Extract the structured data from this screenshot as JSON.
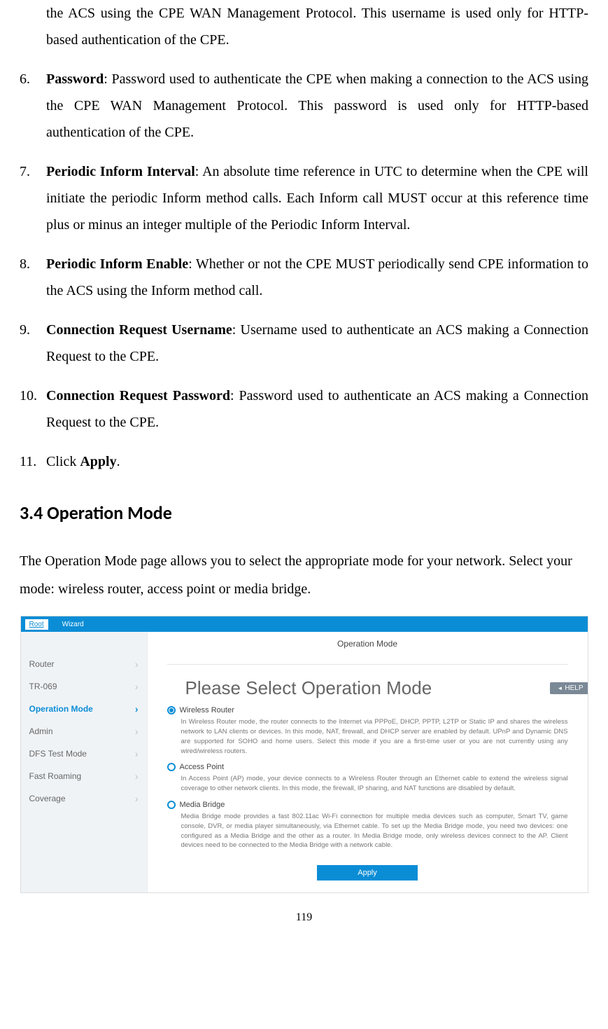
{
  "list": {
    "item5_cont": "the ACS using the CPE WAN Management Protocol. This username is used only for HTTP-based authentication of the CPE.",
    "item6_num": "6.",
    "item6_bold": "Password",
    "item6_text": ": Password used to authenticate the CPE when making a connection to the ACS using the CPE WAN Management Protocol. This password is used only for HTTP-based authentication of the CPE.",
    "item7_num": "7.",
    "item7_bold": "Periodic Inform Interval",
    "item7_text": ": An absolute time reference in UTC to determine when the CPE will initiate the periodic Inform method calls. Each Inform call MUST occur at this reference time plus or minus an integer multiple of the Periodic Inform Interval.",
    "item8_num": "8.",
    "item8_bold": "Periodic Inform Enable",
    "item8_text": ": Whether or not the CPE MUST periodically send CPE information to the ACS using the Inform method call.",
    "item9_num": "9.",
    "item9_bold": "Connection Request Username",
    "item9_text": ": Username used to authenticate an ACS making a Connection Request to the CPE.",
    "item10_num": "10.",
    "item10_bold": "Connection Request Password",
    "item10_text": ": Password used to authenticate an ACS making a Connection Request to the CPE.",
    "item11_num": "11.",
    "item11_pre": "Click ",
    "item11_bold": "Apply",
    "item11_post": "."
  },
  "heading": "3.4 Operation Mode",
  "intro": "The Operation Mode page allows you to select the appropriate mode for your network. Select your mode: wireless router, access point or media bridge.",
  "ss": {
    "tabs": {
      "root": "Root",
      "wizard": "Wizard"
    },
    "sidebar": {
      "i0": "Router",
      "i1": "TR-069",
      "i2": "Operation Mode",
      "i3": "Admin",
      "i4": "DFS Test Mode",
      "i5": "Fast Roaming",
      "i6": "Coverage"
    },
    "chev": "›",
    "main_title": "Operation Mode",
    "help": "HELP",
    "big_head": "Please Select Operation Mode",
    "modes": {
      "m0": {
        "name": "Wireless Router",
        "desc": "In Wireless Router mode, the router connects to the Internet via PPPoE, DHCP, PPTP, L2TP or Static IP and shares the wireless network to LAN clients or devices. In this mode, NAT, firewall, and DHCP server are enabled by default. UPnP and Dynamic DNS are supported for SOHO and home users. Select this mode if you are a first-time user or you are not currently using any wired/wireless routers."
      },
      "m1": {
        "name": "Access Point",
        "desc": "In Access Point (AP) mode, your device connects to a Wireless Router through an Ethernet cable to extend the wireless signal coverage to other network clients. In this mode, the firewall, IP sharing, and NAT functions are disabled by default."
      },
      "m2": {
        "name": "Media Bridge",
        "desc": "Media Bridge mode provides a fast 802.11ac Wi-Fi connection for multiple media devices such as computer, Smart TV, game console, DVR, or media player simultaneously, via Ethernet cable. To set up the Media Bridge mode, you need two devices: one configured as a Media Bridge and the other as a router. In Media Bridge mode, only wireless devices connect to the AP. Client devices need to be connected to the Media Bridge with a network cable."
      }
    },
    "apply": "Apply"
  },
  "page_num": "119"
}
